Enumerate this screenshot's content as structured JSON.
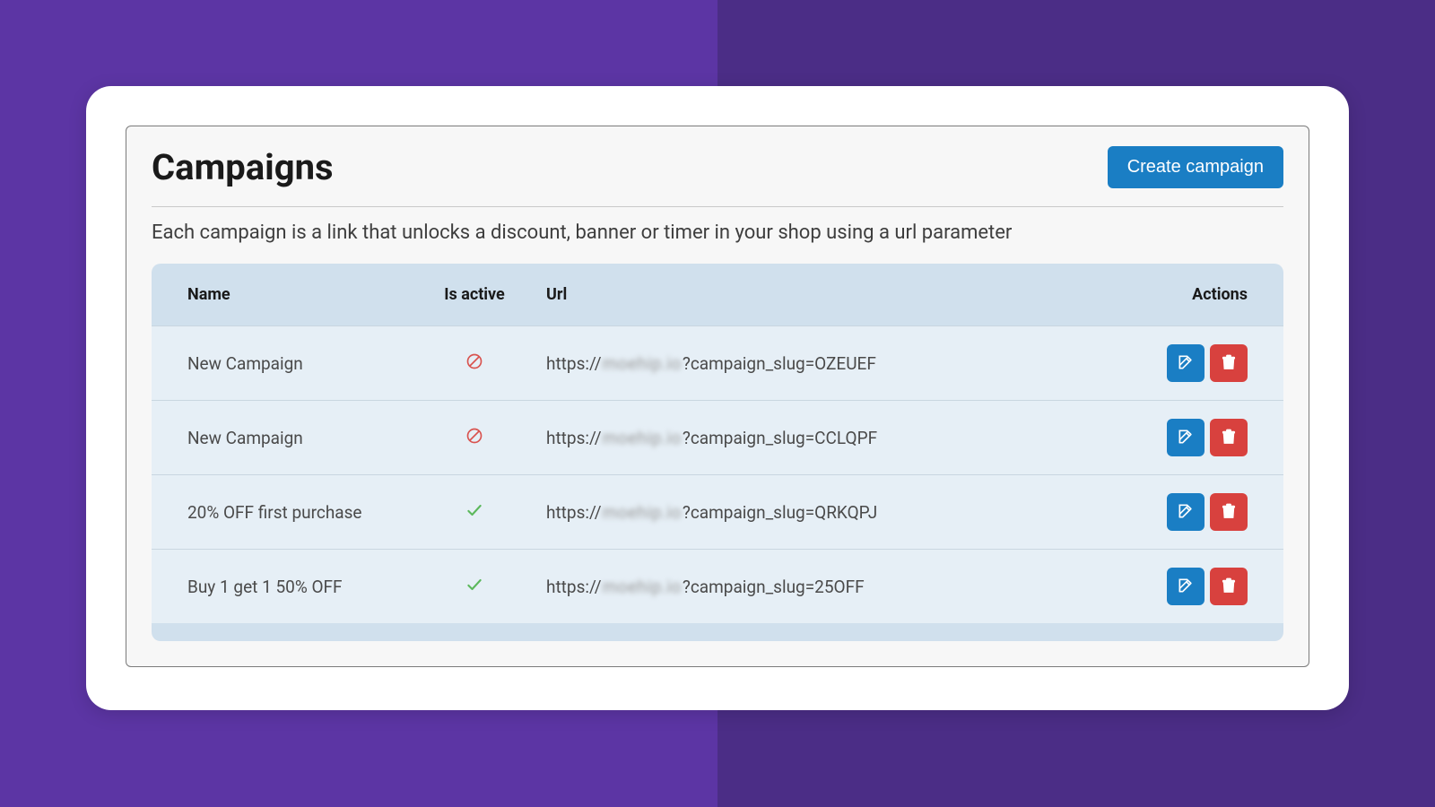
{
  "header": {
    "title": "Campaigns",
    "create_label": "Create campaign",
    "description": "Each campaign is a link that unlocks a discount, banner or timer in your shop using a url parameter"
  },
  "table": {
    "columns": {
      "name": "Name",
      "is_active": "Is active",
      "url": "Url",
      "actions": "Actions"
    },
    "url_prefix": "https://",
    "url_blurred_host": "moehip.io",
    "url_query_key": "?campaign_slug=",
    "rows": [
      {
        "name": "New Campaign",
        "active": false,
        "slug": "OZEUEF"
      },
      {
        "name": "New Campaign",
        "active": false,
        "slug": "CCLQPF"
      },
      {
        "name": "20% OFF first purchase",
        "active": true,
        "slug": "QRKQPJ"
      },
      {
        "name": "Buy 1 get 1 50% OFF",
        "active": true,
        "slug": "25OFF"
      }
    ]
  },
  "icons": {
    "edit": "edit-icon",
    "delete": "trash-icon",
    "active": "check-icon",
    "inactive": "slash-circle-icon"
  }
}
